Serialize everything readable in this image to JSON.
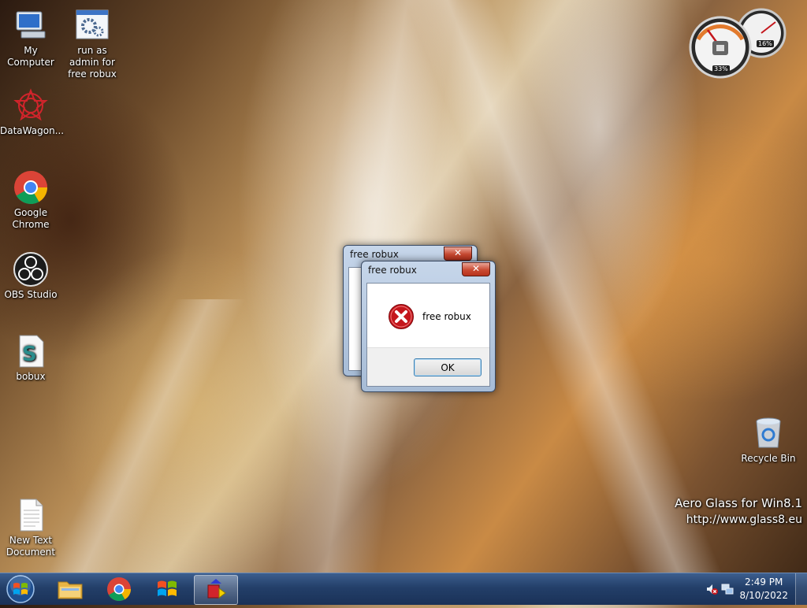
{
  "desktop_icons": [
    {
      "label": "My Computer",
      "icon": "computer-icon"
    },
    {
      "label": "run as admin for free robux",
      "icon": "settings-gears-icon"
    },
    {
      "label": "DataWagon...",
      "icon": "datawagon-icon"
    },
    {
      "label": "Google Chrome",
      "icon": "chrome-icon"
    },
    {
      "label": "OBS Studio",
      "icon": "obs-icon"
    },
    {
      "label": "bobux",
      "icon": "script-file-icon"
    },
    {
      "label": "New Text Document",
      "icon": "text-file-icon"
    },
    {
      "label": "Recycle Bin",
      "icon": "recycle-bin-icon"
    }
  ],
  "dialog_back": {
    "title": "free robux",
    "close": "✕"
  },
  "dialog_front": {
    "title": "free robux",
    "close": "✕",
    "message": "free robux",
    "ok_label": "OK"
  },
  "gadget": {
    "cpu": "33%",
    "memory": "16%"
  },
  "watermark": {
    "line1": "Aero Glass for Win8.1",
    "line2": "http://www.glass8.eu"
  },
  "clock": {
    "time": "2:49 PM",
    "date": "8/10/2022"
  },
  "colors": {
    "taskbar": "#233f69",
    "error_red": "#c4161c",
    "close_red": "#c94a32"
  }
}
